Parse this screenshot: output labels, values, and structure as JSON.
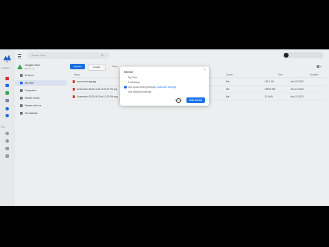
{
  "app": {
    "brand": "DS",
    "nav_label": "Navigation",
    "more_label": "More"
  },
  "search": {
    "placeholder": "Search Drive"
  },
  "sidebar": {
    "drive_title": "Google Drive",
    "drive_sub": "Backed up",
    "items": [
      {
        "label": "All items"
      },
      {
        "label": "My drive"
      },
      {
        "label": "Computers"
      },
      {
        "label": "Shared drives"
      },
      {
        "label": "Shared with me"
      },
      {
        "label": "My backups"
      }
    ]
  },
  "toolbar": {
    "upload": "Upload",
    "create": "Create",
    "more": "More"
  },
  "table": {
    "headers": [
      "Name",
      "Owner",
      "Size",
      "Modified"
    ],
    "rows": [
      {
        "name": "my-main-image.jpg",
        "owner": "Me",
        "size": "102.1 KB",
        "modified": "Nov 23 2023"
      },
      {
        "name": "Screenshot 2023-11-26 at 09.37.PM.png",
        "owner": "Me",
        "size": "189.95 KB",
        "modified": "Nov 24 2023"
      },
      {
        "name": "Screenshot 2023-08-30 at 13.20.PM.png",
        "owner": "Me",
        "size": "31.1 KB",
        "modified": "Nov 22 2023"
      }
    ]
  },
  "dialog": {
    "title": "Backup",
    "close": "×",
    "options": [
      {
        "label": "My Drive",
        "selected": false
      },
      {
        "label": "Full backup",
        "selected": false
      },
      {
        "label": "Use synchronizing settings",
        "link": "(Customize settings)",
        "selected": true
      },
      {
        "label": "Use advanced settings",
        "selected": false
      }
    ],
    "cancel": "Cancel",
    "start": "Start Backup"
  },
  "colors": {
    "accent": "#1a73e8",
    "brand": "#2a63c9",
    "file_icon": "#d93025",
    "drive_green": "#34a853"
  }
}
